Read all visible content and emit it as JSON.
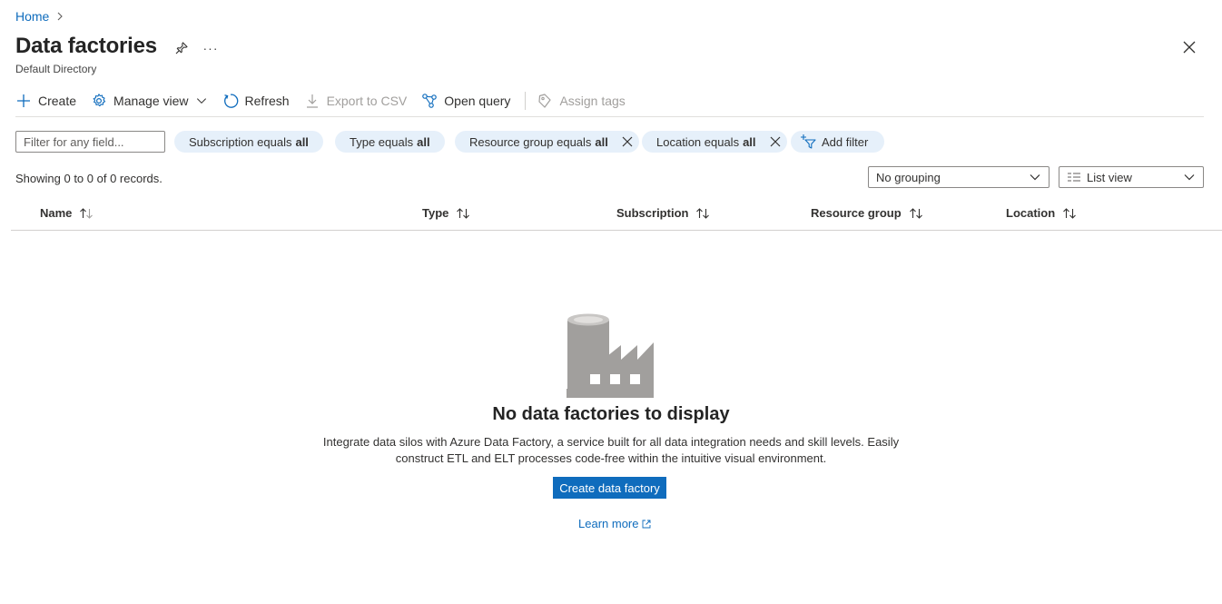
{
  "breadcrumb": {
    "home": "Home"
  },
  "header": {
    "title": "Data factories",
    "subtitle": "Default Directory",
    "more": "···"
  },
  "toolbar": {
    "create": "Create",
    "manage_view": "Manage view",
    "refresh": "Refresh",
    "export_csv": "Export to CSV",
    "open_query": "Open query",
    "assign_tags": "Assign tags"
  },
  "filters": {
    "placeholder": "Filter for any field...",
    "subscription": {
      "prefix": "Subscription equals",
      "value": "all"
    },
    "type": {
      "prefix": "Type equals",
      "value": "all"
    },
    "resource_group": {
      "prefix": "Resource group equals",
      "value": "all"
    },
    "location": {
      "prefix": "Location equals",
      "value": "all"
    },
    "add_filter": "Add filter"
  },
  "records": "Showing 0 to 0 of 0 records.",
  "grouping": {
    "selected": "No grouping"
  },
  "view": {
    "selected": "List view"
  },
  "columns": [
    "Name",
    "Type",
    "Subscription",
    "Resource group",
    "Location"
  ],
  "empty_state": {
    "title": "No data factories to display",
    "description": "Integrate data silos with Azure Data Factory, a service built for all data integration needs and skill levels. Easily construct ETL and ELT processes code-free within the intuitive visual environment.",
    "button": "Create data factory",
    "learn_more": "Learn more"
  },
  "colors": {
    "accent": "#0f6cbd",
    "pill_bg": "#e6f0fa",
    "icon_gray": "#a19f9d"
  }
}
